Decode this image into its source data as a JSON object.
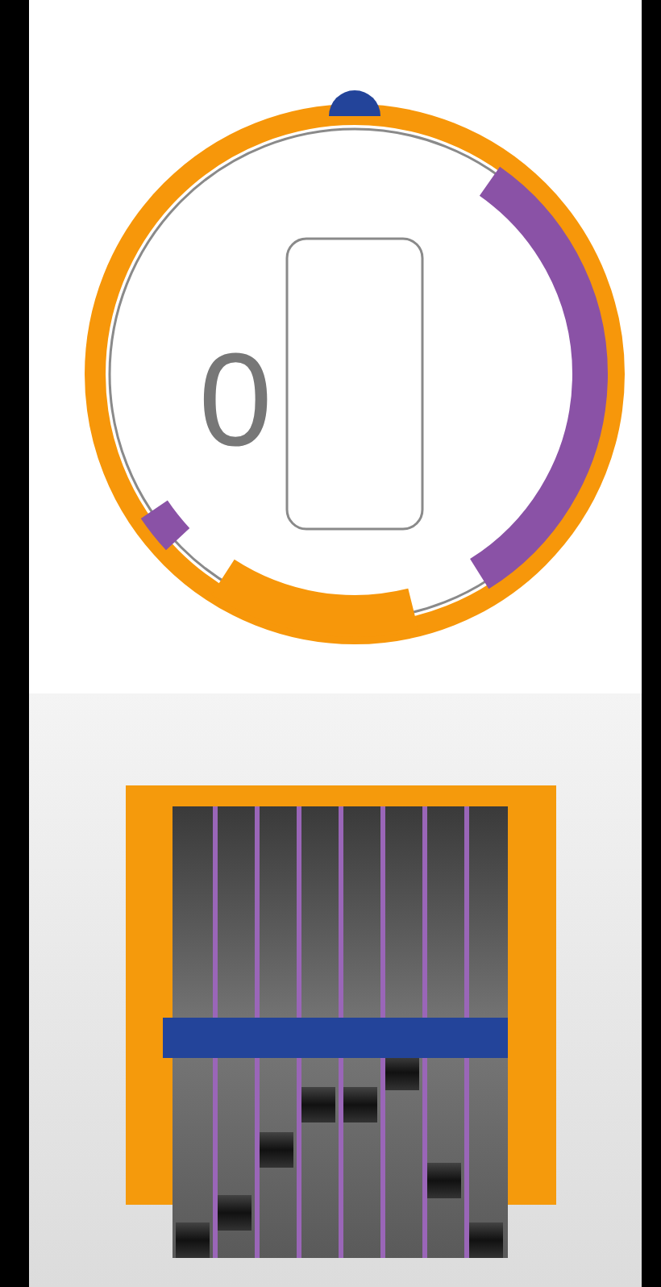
{
  "dial": {
    "value": "0"
  },
  "sequencer": {
    "threshold": {
      "level": 0.49
    },
    "steps": [
      {
        "level": 0.08
      },
      {
        "level": 0.14
      },
      {
        "level": 0.28
      },
      {
        "level": 0.38
      },
      {
        "level": 0.38
      },
      {
        "level": 0.45
      },
      {
        "level": 0.21
      },
      {
        "level": 0.08
      }
    ]
  }
}
